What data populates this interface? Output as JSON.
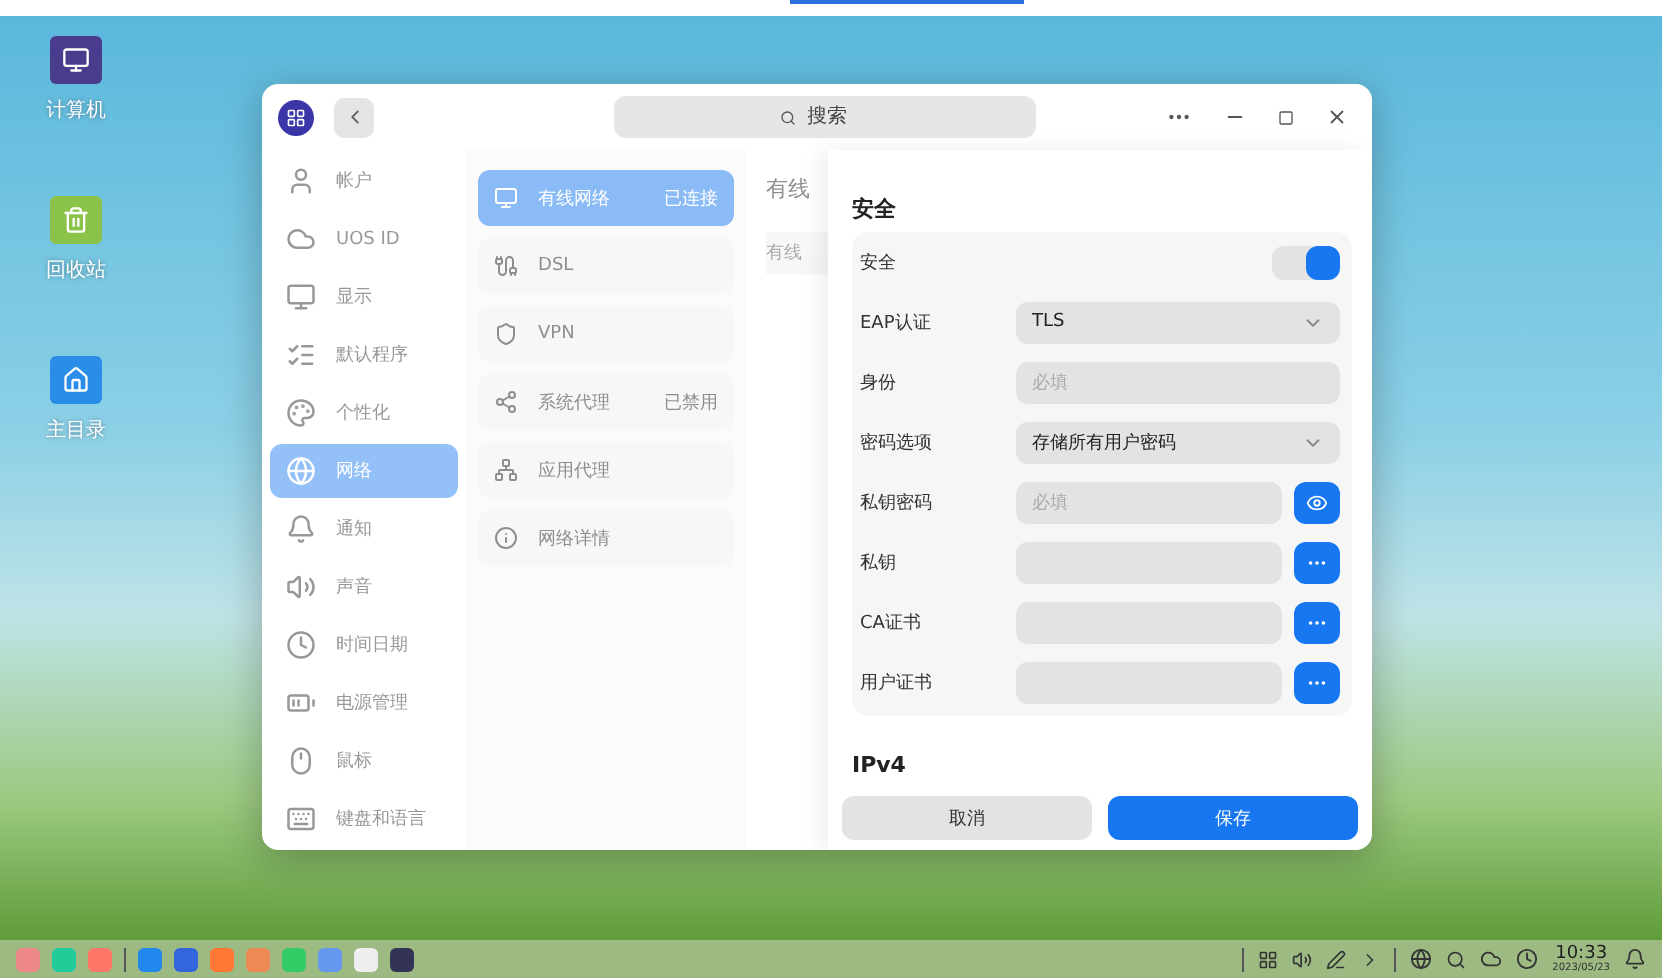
{
  "desktop_icons": [
    {
      "label": "计算机"
    },
    {
      "label": "回收站"
    },
    {
      "label": "主目录"
    }
  ],
  "window": {
    "search": {
      "placeholder": "搜索"
    }
  },
  "sidebar": {
    "items": [
      {
        "label": "帐户",
        "selected": false
      },
      {
        "label": "UOS ID",
        "selected": false
      },
      {
        "label": "显示",
        "selected": false
      },
      {
        "label": "默认程序",
        "selected": false
      },
      {
        "label": "个性化",
        "selected": false
      },
      {
        "label": "网络",
        "selected": true
      },
      {
        "label": "通知",
        "selected": false
      },
      {
        "label": "声音",
        "selected": false
      },
      {
        "label": "时间日期",
        "selected": false
      },
      {
        "label": "电源管理",
        "selected": false
      },
      {
        "label": "鼠标",
        "selected": false
      },
      {
        "label": "键盘和语言",
        "selected": false
      }
    ]
  },
  "network_list": [
    {
      "label": "有线网络",
      "status": "已连接",
      "selected": true
    },
    {
      "label": "DSL",
      "selected": false
    },
    {
      "label": "VPN",
      "selected": false
    },
    {
      "label": "系统代理",
      "status": "已禁用",
      "selected": false
    },
    {
      "label": "应用代理",
      "selected": false
    },
    {
      "label": "网络详情",
      "selected": false
    }
  ],
  "detail_column": {
    "heading": "有线",
    "row": "有线"
  },
  "security": {
    "title": "安全",
    "rows": [
      {
        "kind": "toggle",
        "label": "安全",
        "on": true
      },
      {
        "kind": "select",
        "label": "EAP认证",
        "value": "TLS"
      },
      {
        "kind": "input",
        "label": "身份",
        "placeholder": "必填"
      },
      {
        "kind": "select",
        "label": "密码选项",
        "value": "存储所有用户密码"
      },
      {
        "kind": "password",
        "label": "私钥密码",
        "placeholder": "必填"
      },
      {
        "kind": "file",
        "label": "私钥"
      },
      {
        "kind": "file",
        "label": "CA证书"
      },
      {
        "kind": "file",
        "label": "用户证书"
      }
    ]
  },
  "ipv4": {
    "title": "IPv4"
  },
  "buttons": [
    {
      "label": "取消",
      "kind": "secondary"
    },
    {
      "label": "保存",
      "kind": "primary"
    }
  ],
  "taskbar": {
    "time": "10:33",
    "date": "2023/05/23"
  }
}
